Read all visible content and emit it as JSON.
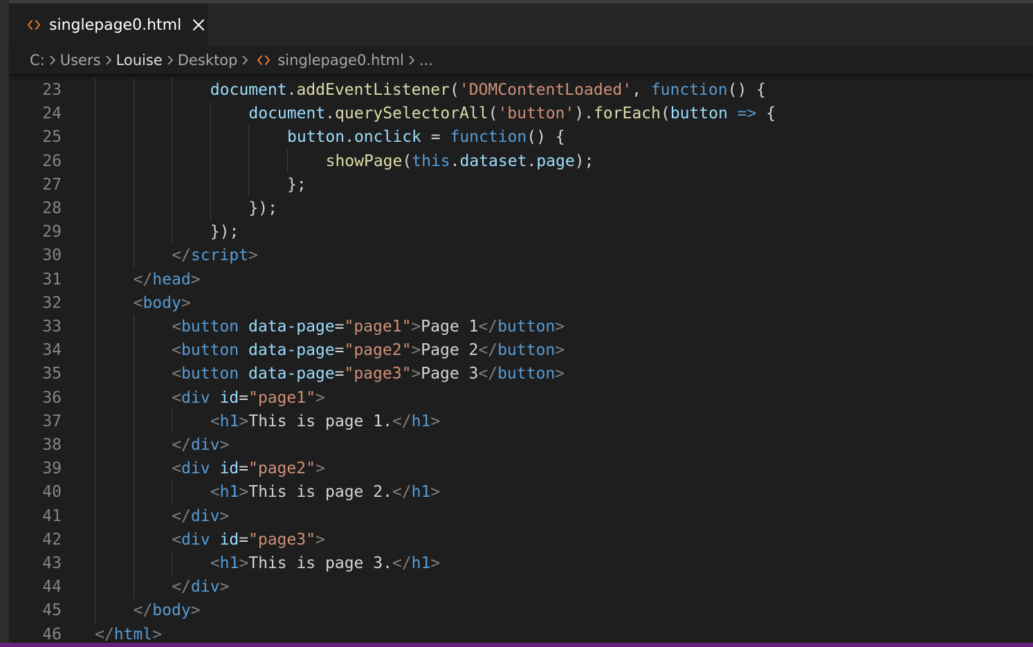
{
  "tab": {
    "title": "singlepage0.html",
    "icon": "code-file-icon",
    "close_icon": "close-icon"
  },
  "breadcrumb": {
    "drive": "C:",
    "items": [
      "Users",
      "Louise",
      "Desktop"
    ],
    "file": "singlepage0.html",
    "more": "..."
  },
  "colors": {
    "accent_bar": "#68217a",
    "file_icon": "#e37933",
    "keyword": "#569cd6",
    "string": "#ce9178",
    "function": "#dcdcaa",
    "variable": "#9cdcfe",
    "tag_bracket": "#808080",
    "attribute": "#9cdcfe",
    "text": "#d4d4d4"
  },
  "editor": {
    "lines": [
      {
        "n": "23",
        "indent": 3,
        "tokens": [
          [
            "document",
            "v"
          ],
          [
            ".",
            "p"
          ],
          [
            "addEventListener",
            "f"
          ],
          [
            "(",
            "p"
          ],
          [
            "'DOMContentLoaded'",
            "s"
          ],
          [
            ", ",
            "p"
          ],
          [
            "function",
            "k"
          ],
          [
            "() {",
            "p"
          ]
        ]
      },
      {
        "n": "24",
        "indent": 4,
        "tokens": [
          [
            "document",
            "v"
          ],
          [
            ".",
            "p"
          ],
          [
            "querySelectorAll",
            "f"
          ],
          [
            "(",
            "p"
          ],
          [
            "'button'",
            "s"
          ],
          [
            ").",
            "p"
          ],
          [
            "forEach",
            "f"
          ],
          [
            "(",
            "p"
          ],
          [
            "button",
            "v"
          ],
          [
            " ",
            "p"
          ],
          [
            "=>",
            "k"
          ],
          [
            " {",
            "p"
          ]
        ]
      },
      {
        "n": "25",
        "indent": 5,
        "tokens": [
          [
            "button",
            "v"
          ],
          [
            ".",
            "p"
          ],
          [
            "onclick",
            "v"
          ],
          [
            " = ",
            "p"
          ],
          [
            "function",
            "k"
          ],
          [
            "() {",
            "p"
          ]
        ]
      },
      {
        "n": "26",
        "indent": 6,
        "tokens": [
          [
            "showPage",
            "f"
          ],
          [
            "(",
            "p"
          ],
          [
            "this",
            "k"
          ],
          [
            ".",
            "p"
          ],
          [
            "dataset",
            "v"
          ],
          [
            ".",
            "p"
          ],
          [
            "page",
            "v"
          ],
          [
            ");",
            "p"
          ]
        ]
      },
      {
        "n": "27",
        "indent": 5,
        "tokens": [
          [
            "};",
            "p"
          ]
        ]
      },
      {
        "n": "28",
        "indent": 4,
        "tokens": [
          [
            "});",
            "p"
          ]
        ]
      },
      {
        "n": "29",
        "indent": 3,
        "tokens": [
          [
            "});",
            "p"
          ]
        ]
      },
      {
        "n": "30",
        "indent": 2,
        "tokens": [
          [
            "</",
            "b"
          ],
          [
            "script",
            "t"
          ],
          [
            ">",
            "b"
          ]
        ]
      },
      {
        "n": "31",
        "indent": 1,
        "tokens": [
          [
            "</",
            "b"
          ],
          [
            "head",
            "t"
          ],
          [
            ">",
            "b"
          ]
        ]
      },
      {
        "n": "32",
        "indent": 1,
        "tokens": [
          [
            "<",
            "b"
          ],
          [
            "body",
            "t"
          ],
          [
            ">",
            "b"
          ]
        ]
      },
      {
        "n": "33",
        "indent": 2,
        "tokens": [
          [
            "<",
            "b"
          ],
          [
            "button",
            "t"
          ],
          [
            " ",
            "p"
          ],
          [
            "data-page",
            "a"
          ],
          [
            "=",
            "p"
          ],
          [
            "\"page1\"",
            "s"
          ],
          [
            ">",
            "b"
          ],
          [
            "Page 1",
            "p"
          ],
          [
            "</",
            "b"
          ],
          [
            "button",
            "t"
          ],
          [
            ">",
            "b"
          ]
        ]
      },
      {
        "n": "34",
        "indent": 2,
        "tokens": [
          [
            "<",
            "b"
          ],
          [
            "button",
            "t"
          ],
          [
            " ",
            "p"
          ],
          [
            "data-page",
            "a"
          ],
          [
            "=",
            "p"
          ],
          [
            "\"page2\"",
            "s"
          ],
          [
            ">",
            "b"
          ],
          [
            "Page 2",
            "p"
          ],
          [
            "</",
            "b"
          ],
          [
            "button",
            "t"
          ],
          [
            ">",
            "b"
          ]
        ]
      },
      {
        "n": "35",
        "indent": 2,
        "tokens": [
          [
            "<",
            "b"
          ],
          [
            "button",
            "t"
          ],
          [
            " ",
            "p"
          ],
          [
            "data-page",
            "a"
          ],
          [
            "=",
            "p"
          ],
          [
            "\"page3\"",
            "s"
          ],
          [
            ">",
            "b"
          ],
          [
            "Page 3",
            "p"
          ],
          [
            "</",
            "b"
          ],
          [
            "button",
            "t"
          ],
          [
            ">",
            "b"
          ]
        ]
      },
      {
        "n": "36",
        "indent": 2,
        "tokens": [
          [
            "<",
            "b"
          ],
          [
            "div",
            "t"
          ],
          [
            " ",
            "p"
          ],
          [
            "id",
            "a"
          ],
          [
            "=",
            "p"
          ],
          [
            "\"page1\"",
            "s"
          ],
          [
            ">",
            "b"
          ]
        ]
      },
      {
        "n": "37",
        "indent": 3,
        "tokens": [
          [
            "<",
            "b"
          ],
          [
            "h1",
            "t"
          ],
          [
            ">",
            "b"
          ],
          [
            "This is page 1.",
            "p"
          ],
          [
            "</",
            "b"
          ],
          [
            "h1",
            "t"
          ],
          [
            ">",
            "b"
          ]
        ]
      },
      {
        "n": "38",
        "indent": 2,
        "tokens": [
          [
            "</",
            "b"
          ],
          [
            "div",
            "t"
          ],
          [
            ">",
            "b"
          ]
        ]
      },
      {
        "n": "39",
        "indent": 2,
        "tokens": [
          [
            "<",
            "b"
          ],
          [
            "div",
            "t"
          ],
          [
            " ",
            "p"
          ],
          [
            "id",
            "a"
          ],
          [
            "=",
            "p"
          ],
          [
            "\"page2\"",
            "s"
          ],
          [
            ">",
            "b"
          ]
        ]
      },
      {
        "n": "40",
        "indent": 3,
        "tokens": [
          [
            "<",
            "b"
          ],
          [
            "h1",
            "t"
          ],
          [
            ">",
            "b"
          ],
          [
            "This is page 2.",
            "p"
          ],
          [
            "</",
            "b"
          ],
          [
            "h1",
            "t"
          ],
          [
            ">",
            "b"
          ]
        ]
      },
      {
        "n": "41",
        "indent": 2,
        "tokens": [
          [
            "</",
            "b"
          ],
          [
            "div",
            "t"
          ],
          [
            ">",
            "b"
          ]
        ]
      },
      {
        "n": "42",
        "indent": 2,
        "tokens": [
          [
            "<",
            "b"
          ],
          [
            "div",
            "t"
          ],
          [
            " ",
            "p"
          ],
          [
            "id",
            "a"
          ],
          [
            "=",
            "p"
          ],
          [
            "\"page3\"",
            "s"
          ],
          [
            ">",
            "b"
          ]
        ]
      },
      {
        "n": "43",
        "indent": 3,
        "tokens": [
          [
            "<",
            "b"
          ],
          [
            "h1",
            "t"
          ],
          [
            ">",
            "b"
          ],
          [
            "This is page 3.",
            "p"
          ],
          [
            "</",
            "b"
          ],
          [
            "h1",
            "t"
          ],
          [
            ">",
            "b"
          ]
        ]
      },
      {
        "n": "44",
        "indent": 2,
        "tokens": [
          [
            "</",
            "b"
          ],
          [
            "div",
            "t"
          ],
          [
            ">",
            "b"
          ]
        ]
      },
      {
        "n": "45",
        "indent": 1,
        "tokens": [
          [
            "</",
            "b"
          ],
          [
            "body",
            "t"
          ],
          [
            ">",
            "b"
          ]
        ]
      },
      {
        "n": "46",
        "indent": 0,
        "tokens": [
          [
            "</",
            "b"
          ],
          [
            "html",
            "t"
          ],
          [
            ">",
            "b"
          ]
        ]
      }
    ]
  }
}
